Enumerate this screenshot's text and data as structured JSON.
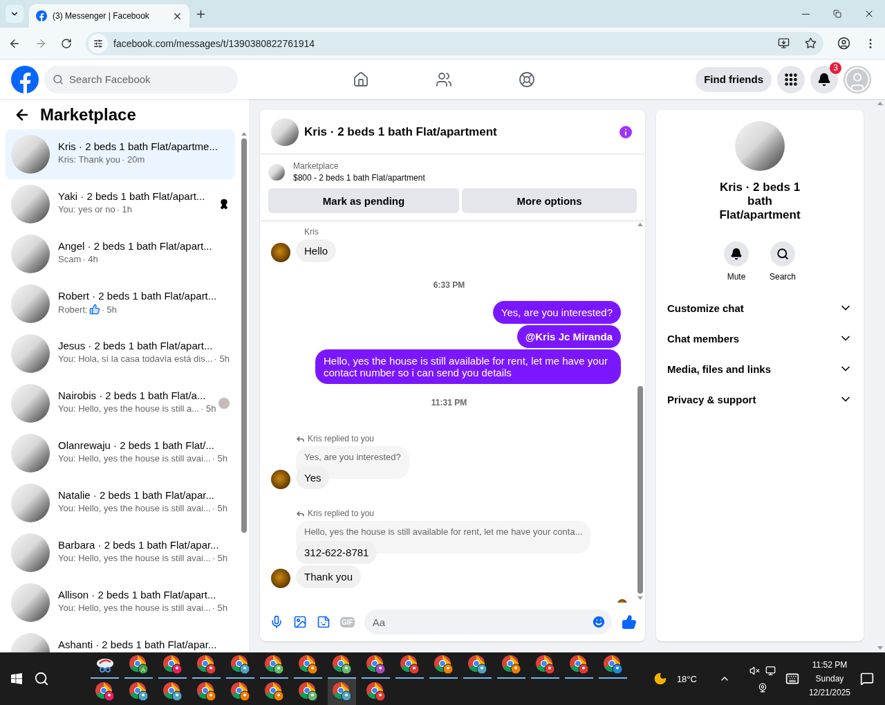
{
  "browser": {
    "tab_title": "(3) Messenger | Facebook",
    "url": "facebook.com/messages/t/1390380822761914"
  },
  "header": {
    "search_placeholder": "Search Facebook",
    "find_friends": "Find friends",
    "notification_count": "3"
  },
  "sidebar": {
    "title": "Marketplace",
    "conversations": [
      {
        "title": "Kris · 2 beds 1 bath Flat/apartme...",
        "preview": "Kris: Thank you",
        "time": "· 20m",
        "kind": "text",
        "ribbon": false,
        "seen_avatar": false,
        "selected": true
      },
      {
        "title": "Yaki · 2 beds 1 bath Flat/apart...",
        "preview": "You: yes or no",
        "time": "· 1h",
        "kind": "text",
        "ribbon": true,
        "seen_avatar": false,
        "selected": false
      },
      {
        "title": "Angel · 2 beds 1 bath Flat/apart...",
        "preview": "Scam",
        "time": "· 4h",
        "kind": "text",
        "ribbon": false,
        "seen_avatar": false,
        "selected": false
      },
      {
        "title": "Robert · 2 beds 1 bath Flat/apart...",
        "preview": "Robert:",
        "time": "· 5h",
        "kind": "like",
        "ribbon": false,
        "seen_avatar": false,
        "selected": false
      },
      {
        "title": "Jesus · 2 beds 1 bath Flat/apart...",
        "preview": "You: Hola, sí la casa todavía está dis...",
        "time": "· 5h",
        "kind": "text",
        "ribbon": false,
        "seen_avatar": false,
        "selected": false
      },
      {
        "title": "Nairobis · 2 beds 1 bath Flat/a...",
        "preview": "You: Hello, yes the house is still a...",
        "time": "· 5h",
        "kind": "text",
        "ribbon": false,
        "seen_avatar": true,
        "selected": false
      },
      {
        "title": "Olanrewaju · 2 beds 1 bath Flat/...",
        "preview": "You: Hello, yes the house is still avai...",
        "time": "· 5h",
        "kind": "text",
        "ribbon": false,
        "seen_avatar": false,
        "selected": false
      },
      {
        "title": "Natalie · 2 beds 1 bath Flat/apar...",
        "preview": "You: Hello, yes the house is still avai...",
        "time": "· 5h",
        "kind": "text",
        "ribbon": false,
        "seen_avatar": false,
        "selected": false
      },
      {
        "title": "Barbara · 2 beds 1 bath Flat/apar...",
        "preview": "You: Hello, yes the house is still avai...",
        "time": "· 5h",
        "kind": "text",
        "ribbon": false,
        "seen_avatar": false,
        "selected": false
      },
      {
        "title": "Allison · 2 beds 1 bath Flat/apart...",
        "preview": "You: Hello, yes the house is still avai...",
        "time": "· 5h",
        "kind": "text",
        "ribbon": false,
        "seen_avatar": false,
        "selected": false
      },
      {
        "title": "Ashanti · 2 beds 1 bath Flat/apar...",
        "selected": false
      }
    ]
  },
  "chat": {
    "title": "Kris · 2 beds 1 bath Flat/apartment",
    "listing": {
      "label": "Marketplace",
      "text": "$800 - 2 beds 1 bath Flat/apartment"
    },
    "actions": [
      "Mark as pending",
      "More options"
    ],
    "messages": [
      {
        "kind": "incoming",
        "sender": "Kris",
        "bubbles": [
          "Hello"
        ]
      },
      {
        "kind": "time",
        "text": "6:33 PM"
      },
      {
        "kind": "outgoing",
        "bubbles": [
          {
            "kind": "text",
            "text": "Yes, are you interested?"
          },
          {
            "kind": "mention",
            "text": "@Kris Jc Miranda"
          },
          {
            "kind": "text",
            "text": "Hello, yes the house is still available for rent, let me have your contact number so i can send you details"
          }
        ]
      },
      {
        "kind": "time",
        "text": "11:31 PM"
      },
      {
        "kind": "reply",
        "label": "Kris replied to you",
        "quoted": "Yes, are you interested?",
        "bubbles": [
          "Yes"
        ]
      },
      {
        "kind": "reply",
        "label": "Kris replied to you",
        "quoted": "Hello, yes the house is still available for rent, let me have your conta...",
        "bubbles": [
          "312-622-8781",
          "Thank you"
        ]
      }
    ],
    "composer": {
      "placeholder": "Aa",
      "gif_label": "GIF"
    }
  },
  "details": {
    "name": "Kris · 2 beds 1 bath Flat/apartment",
    "actions": [
      "Mute",
      "Search"
    ],
    "sections": [
      {
        "label": "Customize chat",
        "expanded": false
      },
      {
        "label": "Chat members",
        "expanded": false
      },
      {
        "label": "Media, files and links",
        "expanded": false
      },
      {
        "label": "Privacy & support",
        "expanded": false
      }
    ]
  },
  "taskbar": {
    "apps": [
      {
        "kind": "snip",
        "active": false
      },
      {
        "kind": "browser",
        "color": "#43a047",
        "letter": "A",
        "active": false
      },
      {
        "kind": "browser",
        "color": "#e91e63",
        "active": false
      },
      {
        "kind": "browser",
        "color": "#e53935",
        "active": false
      },
      {
        "kind": "browser",
        "color": "#4fa3c7",
        "active": false
      },
      {
        "kind": "browser",
        "color": "#66bb6a",
        "active": false
      },
      {
        "kind": "browser",
        "color": "#f57c00",
        "active": false
      },
      {
        "kind": "browser",
        "color": "#66bb6a",
        "active": false
      },
      {
        "kind": "browser",
        "color": "#ab47bc",
        "active": false
      },
      {
        "kind": "browser",
        "color": "#e53935",
        "active": false
      },
      {
        "kind": "browser",
        "color": "#f57c00",
        "active": false
      },
      {
        "kind": "browser",
        "color": "#4fa3c7",
        "active": false
      },
      {
        "kind": "browser",
        "color": "#f57c00",
        "active": false
      },
      {
        "kind": "browser",
        "color": "#e53935",
        "active": false
      },
      {
        "kind": "browser",
        "color": "#e53935",
        "active": false
      },
      {
        "kind": "browser",
        "color": "#1e88e5",
        "active": false
      },
      {
        "kind": "browser",
        "color": "#e91e63",
        "active": false
      },
      {
        "kind": "browser",
        "color": "#4fa3c7",
        "active": false
      },
      {
        "kind": "browser",
        "color": "#4fa3c7",
        "active": false
      },
      {
        "kind": "browser",
        "color": "#f57c00",
        "active": false
      },
      {
        "kind": "browser",
        "color": "#f57c00",
        "active": false
      },
      {
        "kind": "browser",
        "color": "#f57c00",
        "active": false
      },
      {
        "kind": "browser",
        "color": "#66bb6a",
        "active": false
      },
      {
        "kind": "browser",
        "color": "#4fa3c7",
        "active": true
      },
      {
        "kind": "browser",
        "color": "#e53935",
        "active": false
      }
    ],
    "weather": "18°C",
    "time": "11:52 PM",
    "day": "Sunday",
    "date": "12/21/2025"
  }
}
